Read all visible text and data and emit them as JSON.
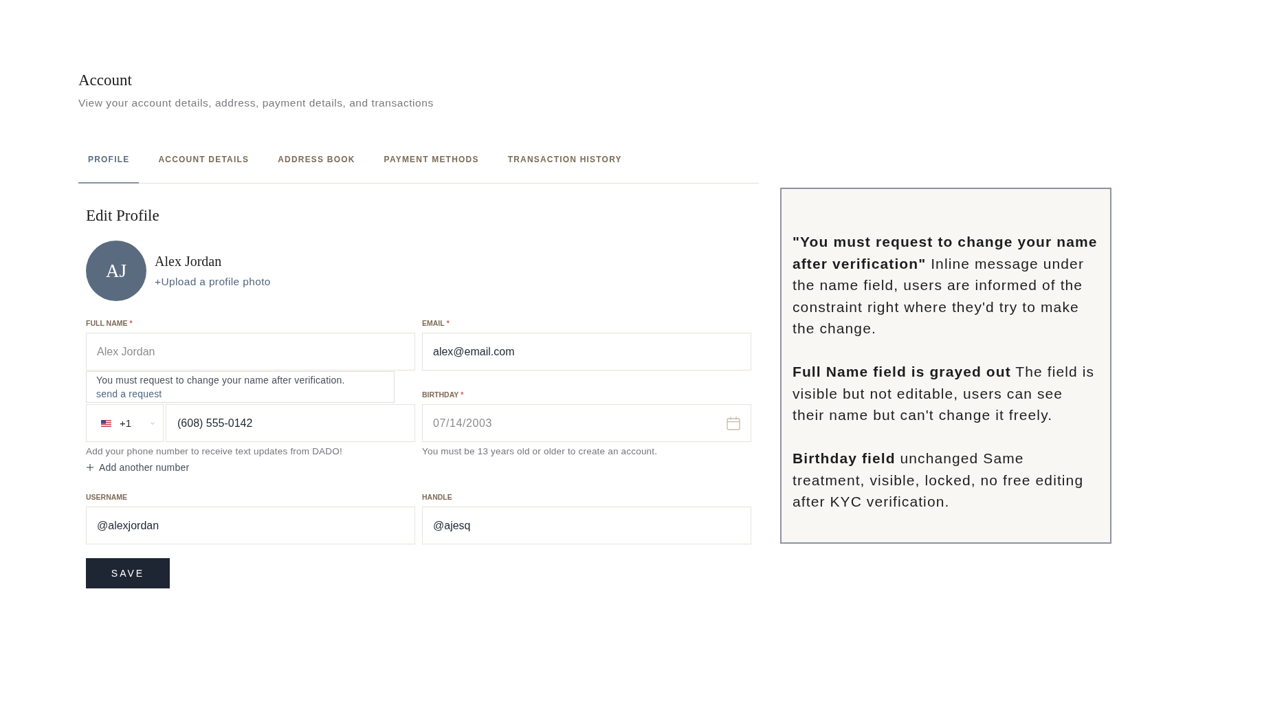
{
  "page": {
    "title": "Account",
    "subtitle": "View your account details, address, payment details, and transactions"
  },
  "tabs": [
    {
      "label": "PROFILE",
      "selected": true
    },
    {
      "label": "ACCOUNT DETAILS",
      "selected": false
    },
    {
      "label": "ADDRESS BOOK",
      "selected": false
    },
    {
      "label": "PAYMENT METHODS",
      "selected": false
    },
    {
      "label": "TRANSACTION HISTORY",
      "selected": false
    }
  ],
  "profile": {
    "heading": "Edit Profile",
    "initials": "AJ",
    "name": "Alex Jordan",
    "upload_link": "+Upload a profile photo"
  },
  "field_rows": [
    {
      "fields": [
        {
          "kind": "text",
          "label": "FULL NAME",
          "required_mark": "*",
          "value": "Alex Jordan",
          "disabled": true,
          "notice": {
            "text": "You must request to change your name after verification.",
            "link": "send a request"
          }
        },
        {
          "kind": "text",
          "label": "EMAIL",
          "required_mark": "*",
          "value": "alex@email.com",
          "disabled": false
        }
      ]
    },
    {
      "fields": [
        {
          "kind": "phone",
          "country_code": "+1",
          "value": "(608) 555-0142",
          "disabled": false,
          "hint": "Add your phone number to receive text updates from DADO!",
          "add_link": "Add another number"
        },
        {
          "kind": "date",
          "label": "BIRTHDAY",
          "required_mark": "*",
          "value": "07/14/2003",
          "disabled": true,
          "hint": "You must be 13 years old or older to create an account."
        }
      ]
    },
    {
      "fields": [
        {
          "kind": "text",
          "label": "USERNAME",
          "value": "@alexjordan",
          "disabled": false
        },
        {
          "kind": "text",
          "label": "HANDLE",
          "value": "@ajesq",
          "disabled": false
        }
      ]
    }
  ],
  "save_button": "SAVE",
  "annotation_panel": {
    "paragraphs": [
      "**\"You must request to change your name after verification\"** Inline message under the name field, users are informed of the constraint right where they'd try to make the change.",
      "**Full Name field is grayed out** The field is visible but not editable, users can see their name but can't change it freely.",
      "**Birthday field** unchanged Same treatment, visible, locked, no free editing after KYC verification."
    ]
  }
}
